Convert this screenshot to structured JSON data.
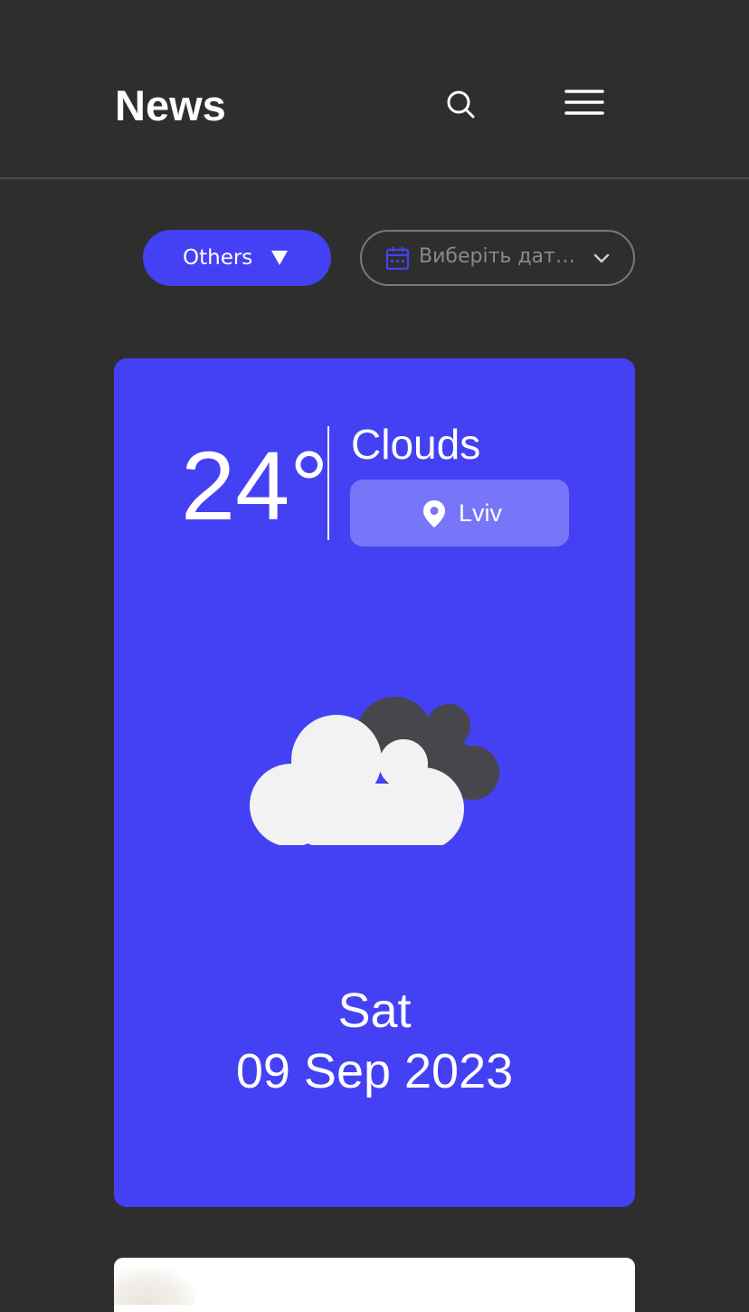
{
  "header": {
    "title": "News",
    "search_icon": "search-icon",
    "menu_icon": "hamburger-menu-icon"
  },
  "filters": {
    "category_label": "Others",
    "date_placeholder": "Виберіть дату...",
    "colors": {
      "accent": "#4441f4",
      "background": "#2e2e2e"
    }
  },
  "weather": {
    "temperature": "24°",
    "condition": "Clouds",
    "location": "Lviv",
    "icon": "partly-cloudy-icon",
    "day": "Sat",
    "date": "09 Sep 2023"
  }
}
